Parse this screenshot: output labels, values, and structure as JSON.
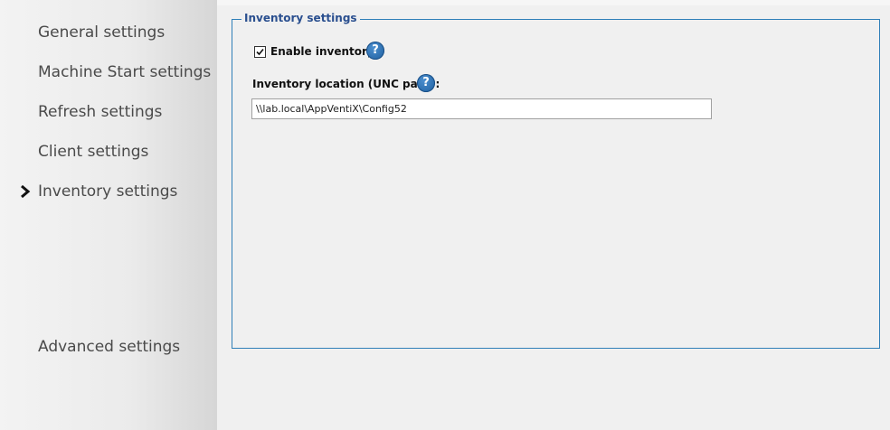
{
  "sidebar": {
    "items": [
      {
        "label": "General settings",
        "selected": false
      },
      {
        "label": "Machine Start settings",
        "selected": false
      },
      {
        "label": "Refresh settings",
        "selected": false
      },
      {
        "label": "Client settings",
        "selected": false
      },
      {
        "label": "Inventory settings",
        "selected": true
      },
      {
        "label": "Advanced settings",
        "selected": false
      }
    ]
  },
  "inventory": {
    "group_title": "Inventory settings",
    "enable_label": "Enable inventory",
    "enable_checked": true,
    "location_label": "Inventory location (UNC path):",
    "location_value": "\\\\lab.local\\AppVentiX\\Config52",
    "help_glyph": "?"
  },
  "colors": {
    "accent_border": "#2f7fb8",
    "group_title": "#2a4f8f",
    "help_icon": "#2b6cb0"
  },
  "icons": {
    "nav_selected": "chevron-right-icon",
    "help": "question-help-icon",
    "check": "check-icon"
  }
}
